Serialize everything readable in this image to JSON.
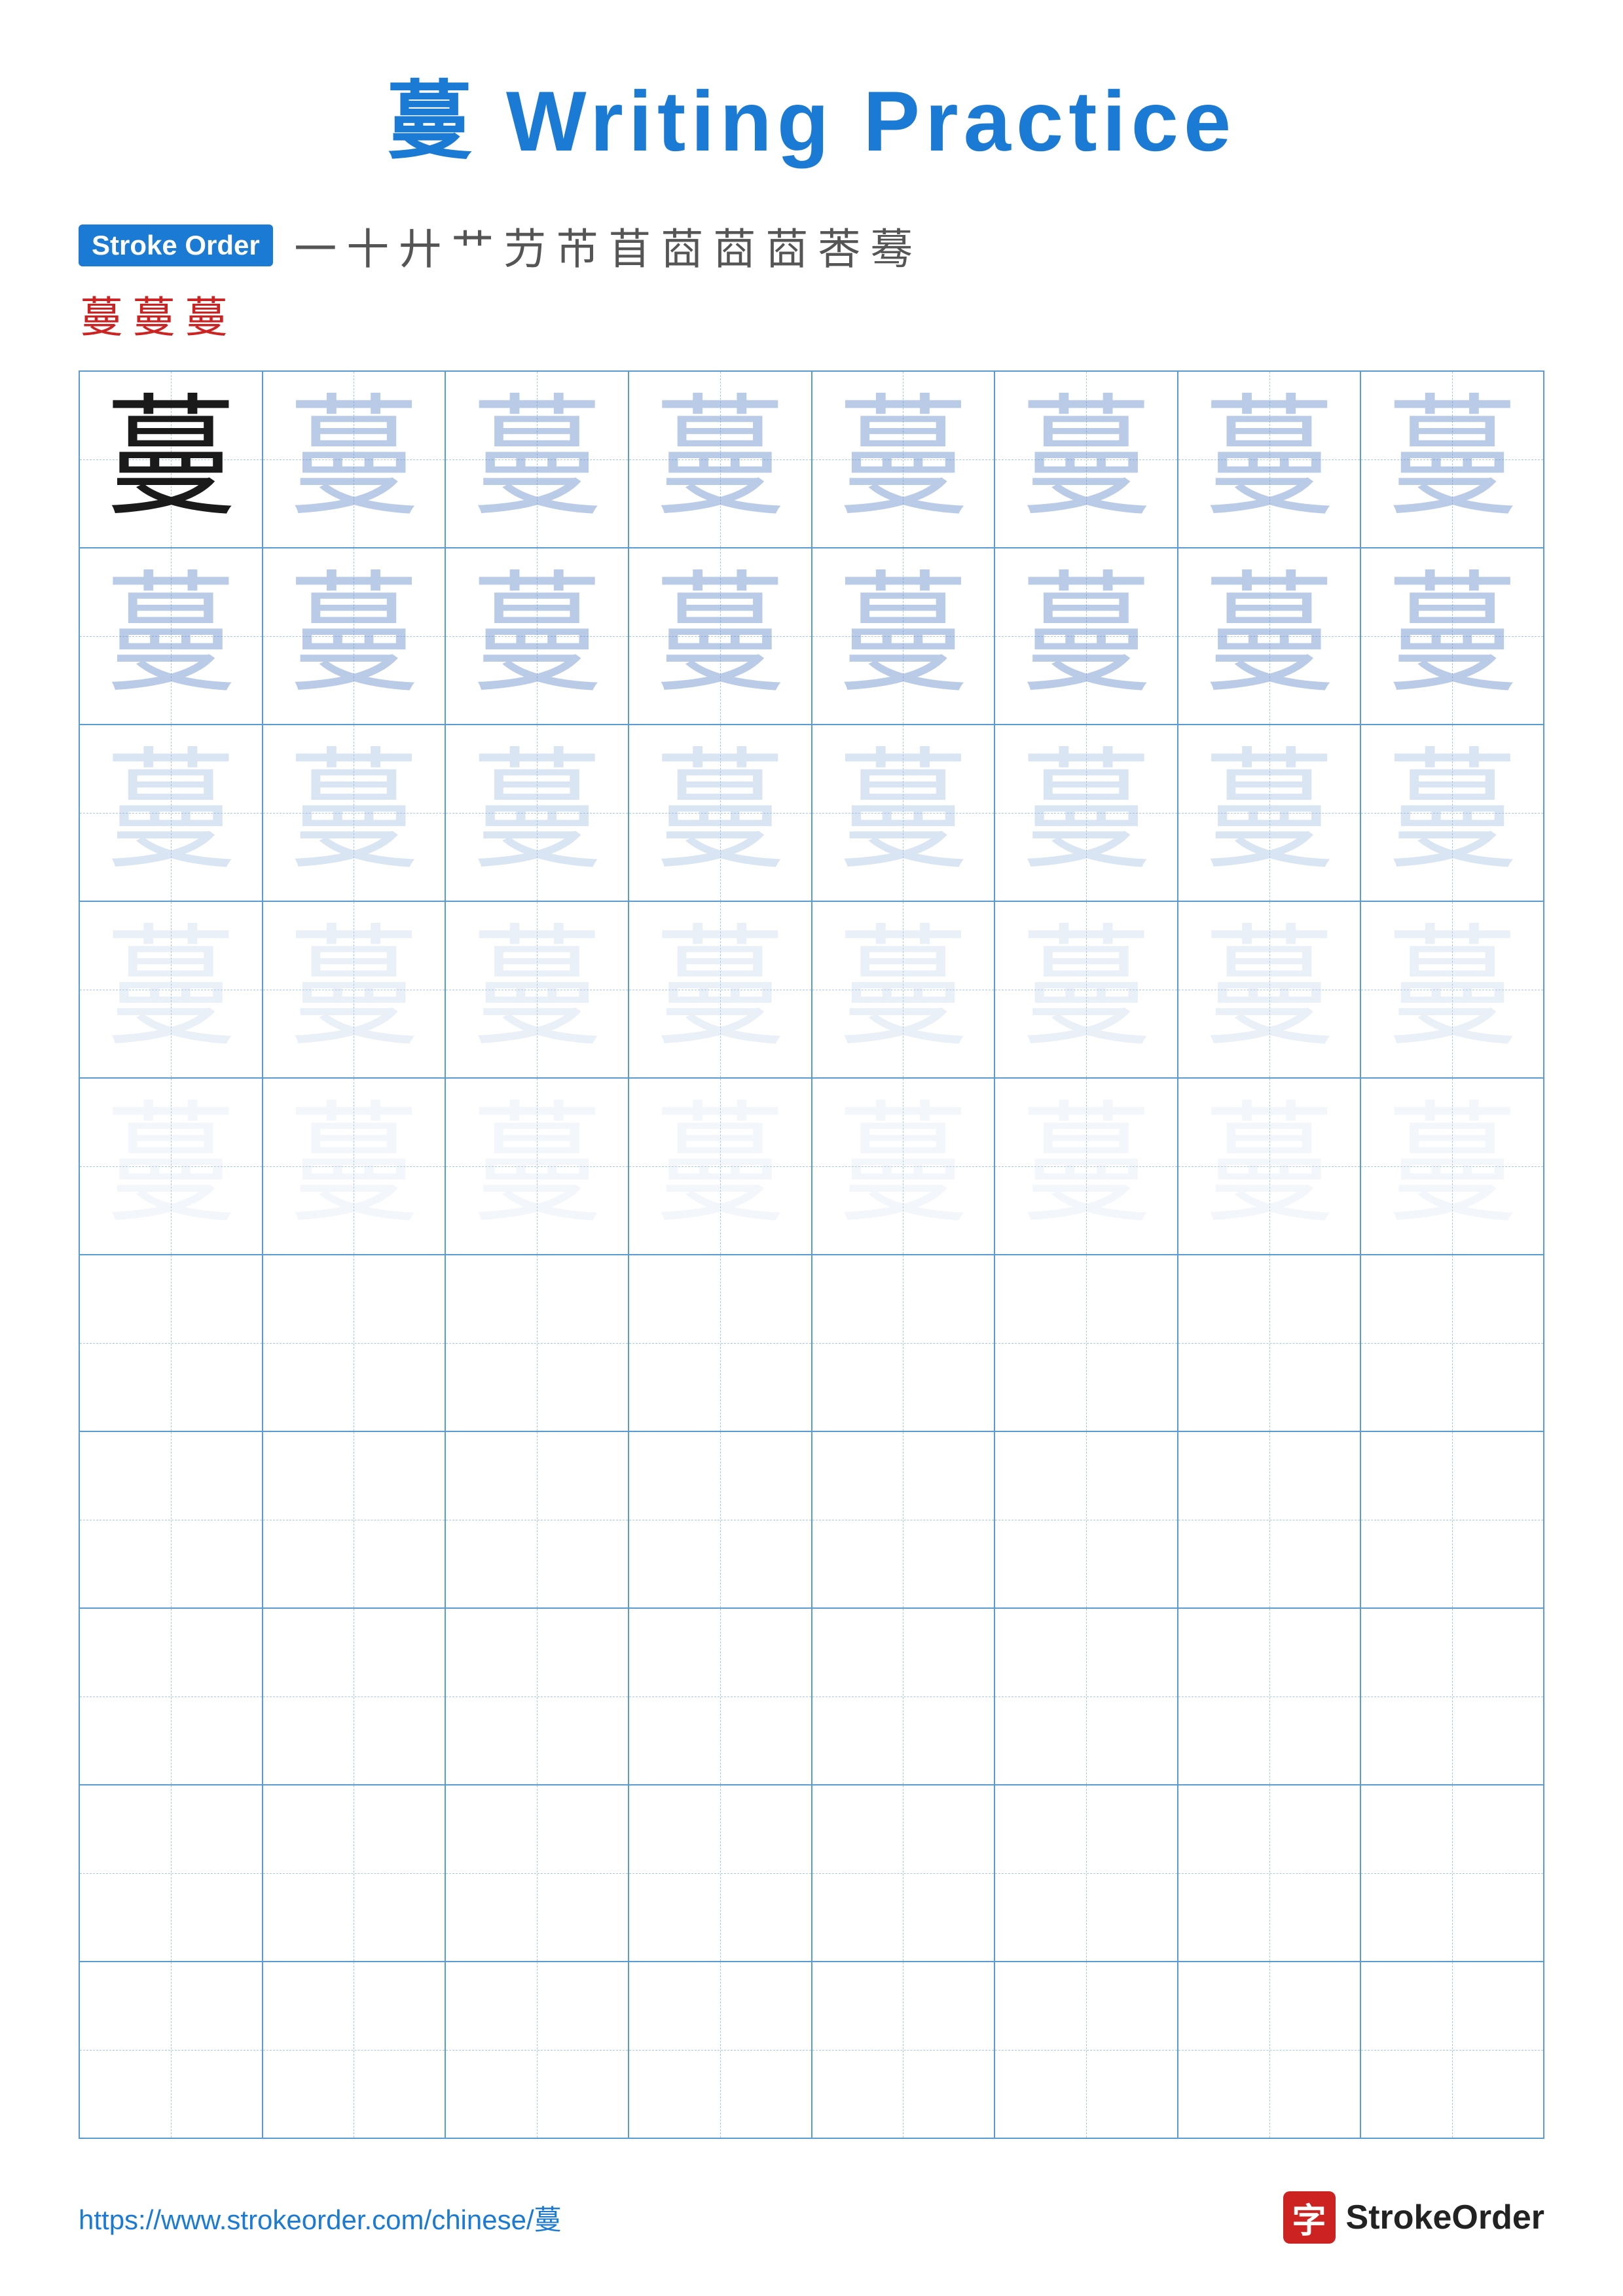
{
  "title": {
    "char": "蔓",
    "text": " Writing Practice"
  },
  "stroke_order": {
    "badge_label": "Stroke Order",
    "strokes_row1": [
      "一",
      "十",
      "廾",
      "艹",
      "芀",
      "芇",
      "苜",
      "莔",
      "莔",
      "莔",
      "莕",
      "蓦"
    ],
    "strokes_row2": [
      "蔓",
      "蔓",
      "蔓"
    ],
    "red_indices": [
      0,
      1,
      2
    ]
  },
  "grid": {
    "rows": 10,
    "cols": 8,
    "character": "蔓",
    "practice_rows": 5,
    "empty_rows": 5
  },
  "footer": {
    "url": "https://www.strokeorder.com/chinese/蔓",
    "logo_text": "StrokeOrder",
    "logo_char": "字"
  }
}
